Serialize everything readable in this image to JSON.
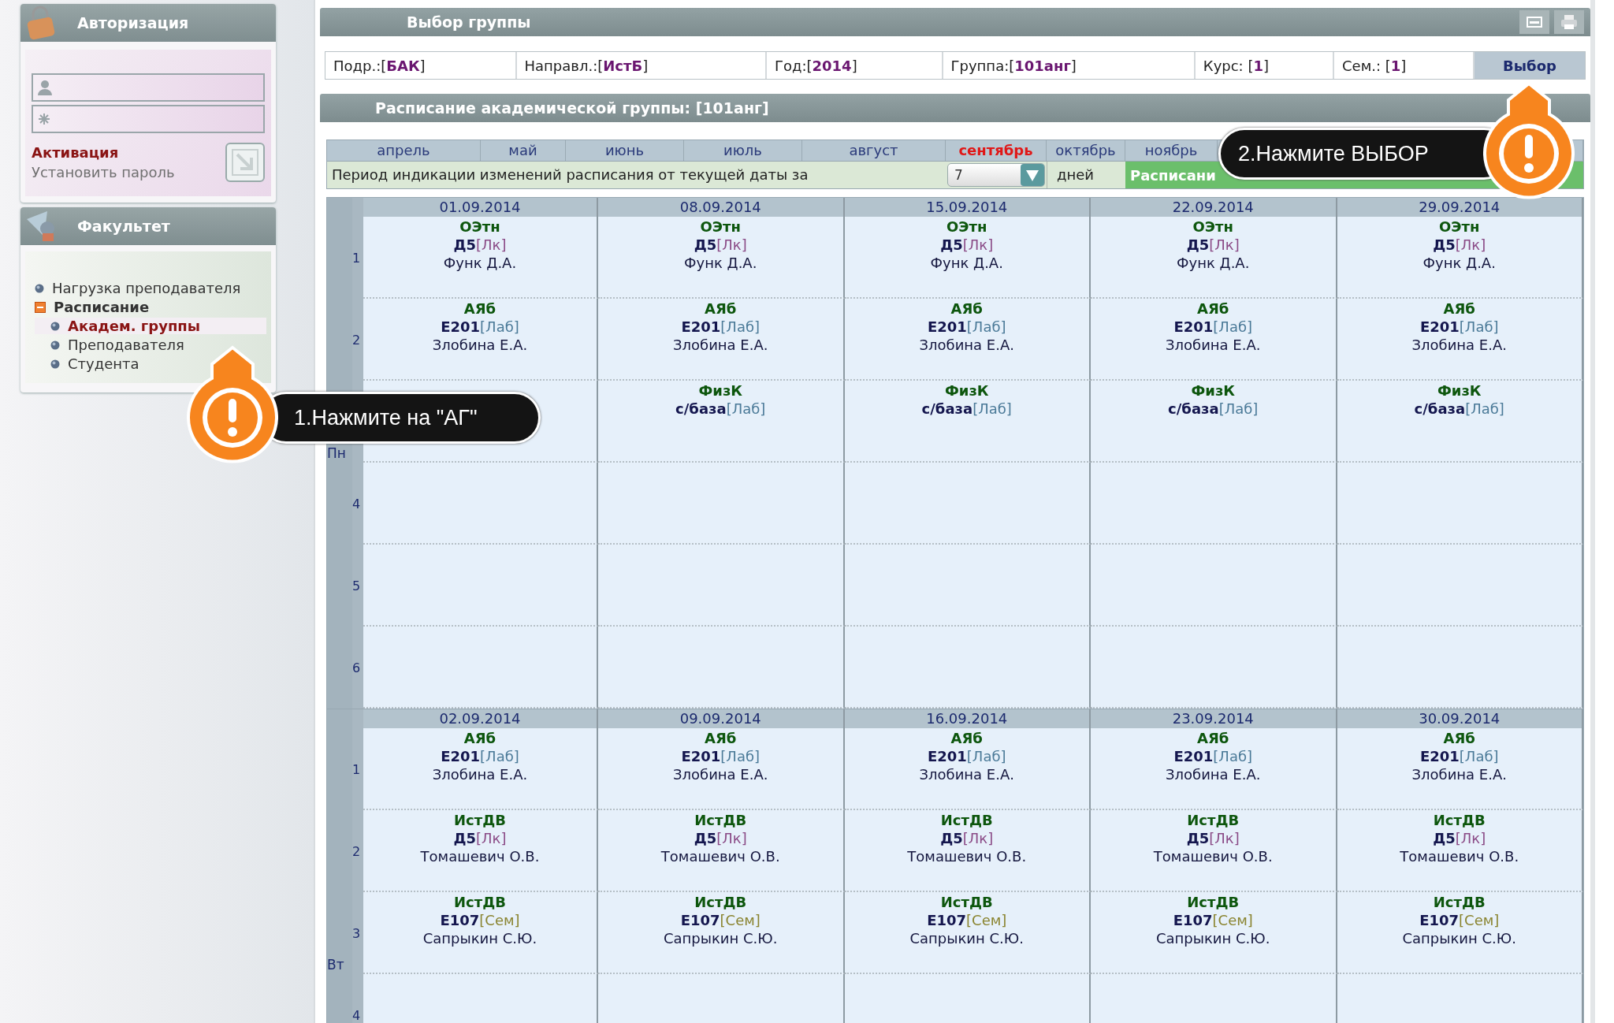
{
  "sidebar": {
    "auth": {
      "title": "Авторизация",
      "activation_link": "Активация",
      "set_password_link": "Установить пароль"
    },
    "faculty": {
      "title": "Факультет",
      "items": [
        {
          "label": "Нагрузка преподавателя",
          "selected": false
        },
        {
          "label": "Расписание",
          "expanded": true,
          "selected": false,
          "children": [
            {
              "label": "Академ. группы",
              "selected": true
            },
            {
              "label": "Преподавателя",
              "selected": false
            },
            {
              "label": "Студента",
              "selected": false
            }
          ]
        }
      ]
    }
  },
  "group_select": {
    "title": "Выбор группы",
    "fields": [
      "Подр.:[**БАК**]",
      "Направл.:[**ИстБ**]",
      "Год:[**2014**]",
      "Группа:[**101анг**]",
      "Курс: [**1**]",
      "Сем.: [**1**]"
    ],
    "button": "Выбор"
  },
  "schedule": {
    "title": "Расписание академической группы: [101анг]",
    "months": [
      {
        "label": "апрель",
        "selected": false
      },
      {
        "label": "май",
        "selected": false
      },
      {
        "label": "июнь",
        "selected": false
      },
      {
        "label": "июль",
        "selected": false
      },
      {
        "label": "август",
        "selected": false
      },
      {
        "label": "сентябрь",
        "selected": true
      },
      {
        "label": "октябрь",
        "selected": false
      },
      {
        "label": "ноябрь",
        "selected": false
      }
    ],
    "period": {
      "label": "Период индикации изменений расписания от текущей даты за",
      "value": "7",
      "unit": "дней",
      "mobile_button": "Расписани"
    },
    "days": [
      {
        "label": "Пн",
        "dates": [
          "01.09.2014",
          "08.09.2014",
          "15.09.2014",
          "22.09.2014",
          "29.09.2014"
        ],
        "slots": [
          {
            "number": "1",
            "cells": [
              {
                "subject": "ОЭтн",
                "room": "Д5",
                "type": "[Лк]",
                "kind": "lecture",
                "teacher": "Функ Д.А."
              },
              {
                "subject": "ОЭтн",
                "room": "Д5",
                "type": "[Лк]",
                "kind": "lecture",
                "teacher": "Функ Д.А."
              },
              {
                "subject": "ОЭтн",
                "room": "Д5",
                "type": "[Лк]",
                "kind": "lecture",
                "teacher": "Функ Д.А."
              },
              {
                "subject": "ОЭтн",
                "room": "Д5",
                "type": "[Лк]",
                "kind": "lecture",
                "teacher": "Функ Д.А."
              },
              {
                "subject": "ОЭтн",
                "room": "Д5",
                "type": "[Лк]",
                "kind": "lecture",
                "teacher": "Функ Д.А."
              }
            ]
          },
          {
            "number": "2",
            "cells": [
              {
                "subject": "АЯб",
                "room": "Е201",
                "type": "[Лаб]",
                "kind": "lab",
                "teacher": "Злобина Е.А."
              },
              {
                "subject": "АЯб",
                "room": "Е201",
                "type": "[Лаб]",
                "kind": "lab",
                "teacher": "Злобина Е.А."
              },
              {
                "subject": "АЯб",
                "room": "Е201",
                "type": "[Лаб]",
                "kind": "lab",
                "teacher": "Злобина Е.А."
              },
              {
                "subject": "АЯб",
                "room": "Е201",
                "type": "[Лаб]",
                "kind": "lab",
                "teacher": "Злобина Е.А."
              },
              {
                "subject": "АЯб",
                "room": "Е201",
                "type": "[Лаб]",
                "kind": "lab",
                "teacher": "Злобина Е.А."
              }
            ]
          },
          {
            "cells": [
              null,
              {
                "subject": "ФизК",
                "room": "с/база",
                "type": "[Лаб]",
                "kind": "lab"
              },
              {
                "subject": "ФизК",
                "room": "с/база",
                "type": "[Лаб]",
                "kind": "lab"
              },
              {
                "subject": "ФизК",
                "room": "с/база",
                "type": "[Лаб]",
                "kind": "lab"
              },
              {
                "subject": "ФизК",
                "room": "с/база",
                "type": "[Лаб]",
                "kind": "lab"
              }
            ]
          },
          {
            "number": "4"
          },
          {
            "number": "5"
          },
          {
            "number": "6"
          }
        ]
      },
      {
        "label": "Вт",
        "dates": [
          "02.09.2014",
          "09.09.2014",
          "16.09.2014",
          "23.09.2014",
          "30.09.2014"
        ],
        "slots": [
          {
            "number": "1",
            "cells": [
              {
                "subject": "АЯб",
                "room": "Е201",
                "type": "[Лаб]",
                "kind": "lab",
                "teacher": "Злобина Е.А."
              },
              {
                "subject": "АЯб",
                "room": "Е201",
                "type": "[Лаб]",
                "kind": "lab",
                "teacher": "Злобина Е.А."
              },
              {
                "subject": "АЯб",
                "room": "Е201",
                "type": "[Лаб]",
                "kind": "lab",
                "teacher": "Злобина Е.А."
              },
              {
                "subject": "АЯб",
                "room": "Е201",
                "type": "[Лаб]",
                "kind": "lab",
                "teacher": "Злобина Е.А."
              },
              {
                "subject": "АЯб",
                "room": "Е201",
                "type": "[Лаб]",
                "kind": "lab",
                "teacher": "Злобина Е.А."
              }
            ]
          },
          {
            "number": "2",
            "cells": [
              {
                "subject": "ИстДВ",
                "room": "Д5",
                "type": "[Лк]",
                "kind": "lecture",
                "teacher": "Томашевич О.В."
              },
              {
                "subject": "ИстДВ",
                "room": "Д5",
                "type": "[Лк]",
                "kind": "lecture",
                "teacher": "Томашевич О.В."
              },
              {
                "subject": "ИстДВ",
                "room": "Д5",
                "type": "[Лк]",
                "kind": "lecture",
                "teacher": "Томашевич О.В."
              },
              {
                "subject": "ИстДВ",
                "room": "Д5",
                "type": "[Лк]",
                "kind": "lecture",
                "teacher": "Томашевич О.В."
              },
              {
                "subject": "ИстДВ",
                "room": "Д5",
                "type": "[Лк]",
                "kind": "lecture",
                "teacher": "Томашевич О.В."
              }
            ]
          },
          {
            "number": "3",
            "cells": [
              {
                "subject": "ИстДВ",
                "room": "Е107",
                "type": "[Сем]",
                "kind": "seminar",
                "teacher": "Сапрыкин С.Ю."
              },
              {
                "subject": "ИстДВ",
                "room": "Е107",
                "type": "[Сем]",
                "kind": "seminar",
                "teacher": "Сапрыкин С.Ю."
              },
              {
                "subject": "ИстДВ",
                "room": "Е107",
                "type": "[Сем]",
                "kind": "seminar",
                "teacher": "Сапрыкин С.Ю."
              },
              {
                "subject": "ИстДВ",
                "room": "Е107",
                "type": "[Сем]",
                "kind": "seminar",
                "teacher": "Сапрыкин С.Ю."
              },
              {
                "subject": "ИстДВ",
                "room": "Е107",
                "type": "[Сем]",
                "kind": "seminar",
                "teacher": "Сапрыкин С.Ю."
              }
            ]
          },
          {
            "number": "4"
          }
        ]
      }
    ]
  },
  "callouts": [
    {
      "text": "1.Нажмите на \"АГ\""
    },
    {
      "text": "2.Нажмите ВЫБОР"
    }
  ]
}
